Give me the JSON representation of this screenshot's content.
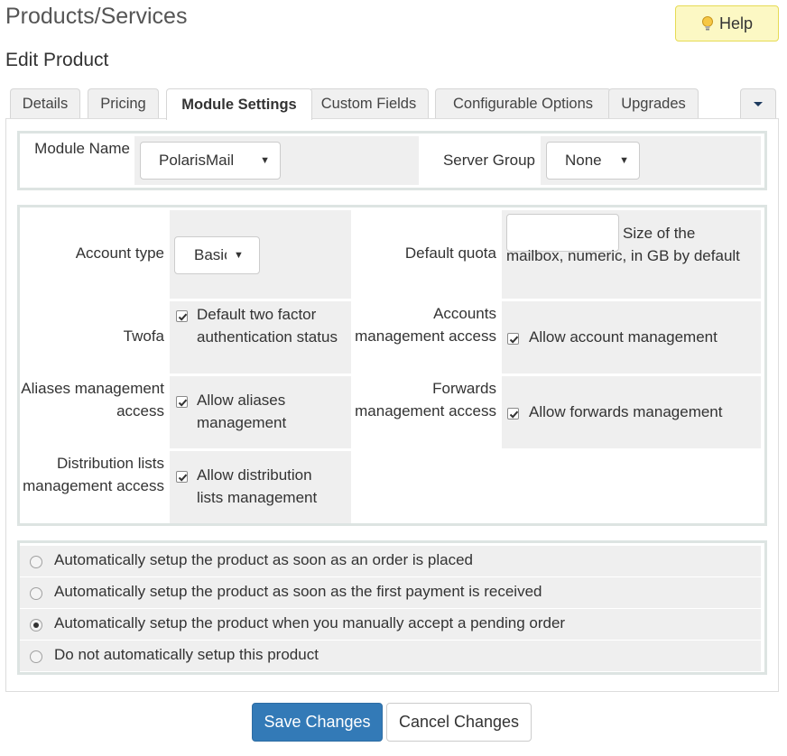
{
  "page": {
    "title": "Products/Services",
    "subtitle": "Edit Product",
    "help_label": "Help"
  },
  "tabs": [
    {
      "label": "Details"
    },
    {
      "label": "Pricing"
    },
    {
      "label": "Module Settings",
      "active": true
    },
    {
      "label": "Custom Fields"
    },
    {
      "label": "Configurable Options"
    },
    {
      "label": "Upgrades"
    }
  ],
  "module": {
    "module_name_label": "Module Name",
    "module_name_value": "PolarisMail",
    "server_group_label": "Server Group",
    "server_group_value": "None"
  },
  "settings": {
    "account_type_label": "Account type",
    "account_type_value": "Basic",
    "default_quota_label": "Default quota",
    "default_quota_value": "",
    "default_quota_help": "Size of the mailbox, numeric, in GB by default",
    "twofa_label": "Twofa",
    "twofa_text": "Default two factor authentication status",
    "twofa_checked": true,
    "accounts_mgmt_label": "Accounts management access",
    "accounts_mgmt_text": "Allow account management",
    "accounts_mgmt_checked": true,
    "aliases_mgmt_label": "Aliases management access",
    "aliases_mgmt_text": "Allow aliases management",
    "aliases_mgmt_checked": true,
    "forwards_mgmt_label": "Forwards management access",
    "forwards_mgmt_text": "Allow forwards management",
    "forwards_mgmt_checked": true,
    "distlists_mgmt_label": "Distribution lists management access",
    "distlists_mgmt_text": "Allow distribution lists management",
    "distlists_mgmt_checked": true
  },
  "setup_options": [
    {
      "label": "Automatically setup the product as soon as an order is placed",
      "selected": false
    },
    {
      "label": "Automatically setup the product as soon as the first payment is received",
      "selected": false
    },
    {
      "label": "Automatically setup the product when you manually accept a pending order",
      "selected": true
    },
    {
      "label": "Do not automatically setup this product",
      "selected": false
    }
  ],
  "actions": {
    "save_label": "Save Changes",
    "cancel_label": "Cancel Changes"
  },
  "colors": {
    "primary": "#337ab7",
    "help_bg": "#fcf8c4",
    "field_bg": "#efefef",
    "box_border": "#dde4e2"
  },
  "icons": {
    "help": "lightbulb-icon",
    "tab_more": "caret-down-icon",
    "select_arrow": "triangle-down-icon"
  }
}
